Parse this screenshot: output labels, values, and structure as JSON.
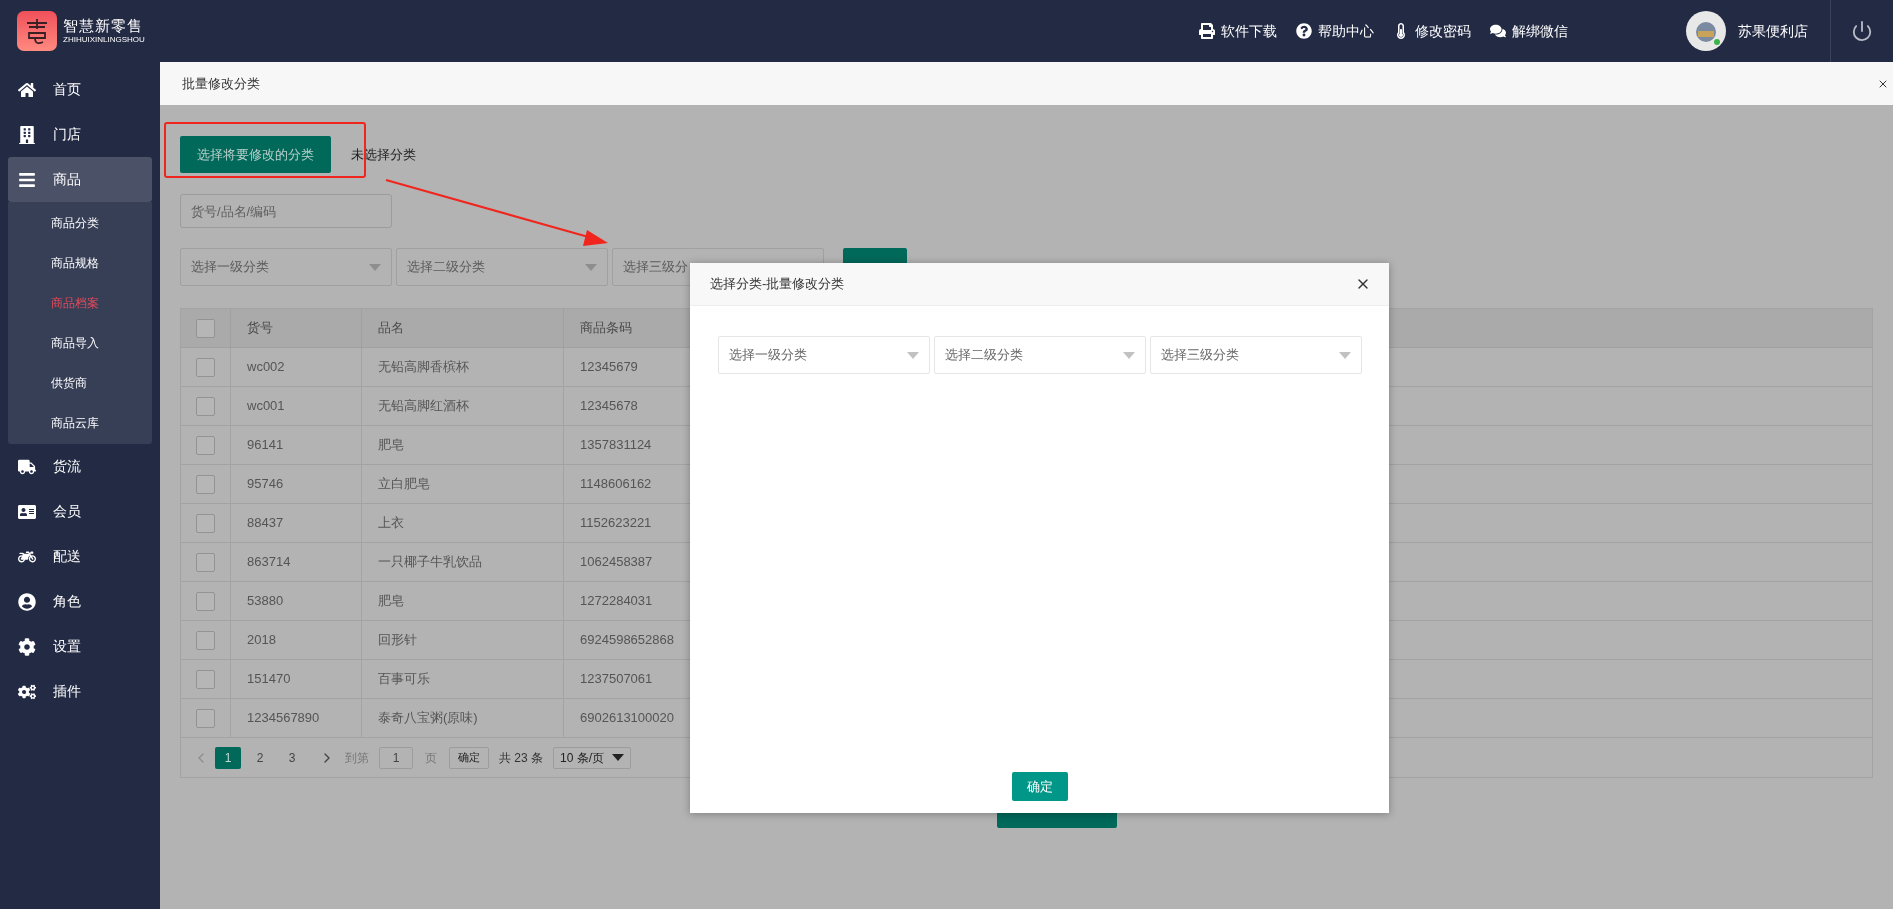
{
  "brand": {
    "name": "智慧新零售",
    "subtitle": "ZHIHUIXINLINGSHOU"
  },
  "top_links": [
    {
      "kind": "download",
      "label": "软件下载"
    },
    {
      "kind": "help",
      "label": "帮助中心"
    },
    {
      "kind": "password",
      "label": "修改密码"
    },
    {
      "kind": "wechat",
      "label": "解绑微信"
    }
  ],
  "user": {
    "name": "苏果便利店"
  },
  "sidebar": {
    "items": [
      {
        "kind": "home",
        "label": "首页",
        "selected": false
      },
      {
        "kind": "store",
        "label": "门店",
        "selected": false
      },
      {
        "kind": "goods",
        "label": "商品",
        "selected": true,
        "expanded": true,
        "children": [
          {
            "label": "商品分类",
            "selected": false
          },
          {
            "label": "商品规格",
            "selected": false
          },
          {
            "label": "商品档案",
            "selected": true
          },
          {
            "label": "商品导入",
            "selected": false
          },
          {
            "label": "供货商",
            "selected": false
          },
          {
            "label": "商品云库",
            "selected": false
          }
        ]
      },
      {
        "kind": "logistics",
        "label": "货流",
        "selected": false
      },
      {
        "kind": "member",
        "label": "会员",
        "selected": false
      },
      {
        "kind": "delivery",
        "label": "配送",
        "selected": false
      },
      {
        "kind": "role",
        "label": "角色",
        "selected": false
      },
      {
        "kind": "settings",
        "label": "设置",
        "selected": false
      },
      {
        "kind": "plugins",
        "label": "插件",
        "selected": false
      }
    ]
  },
  "page": {
    "title": "批量修改分类"
  },
  "toolbar": {
    "choose_button": "选择将要修改的分类",
    "selection_status": "未选择分类"
  },
  "search": {
    "placeholder": "货号/品名/编码"
  },
  "filters": [
    {
      "placeholder": "选择一级分类"
    },
    {
      "placeholder": "选择二级分类"
    },
    {
      "placeholder": "选择三级分"
    }
  ],
  "table": {
    "columns": [
      "货号",
      "品名",
      "商品条码"
    ],
    "header_checked": false,
    "rows": [
      {
        "checked": false,
        "cells": [
          "wc002",
          "无铅高脚香槟杯",
          "12345679"
        ]
      },
      {
        "checked": false,
        "cells": [
          "wc001",
          "无铅高脚红酒杯",
          "12345678"
        ]
      },
      {
        "checked": false,
        "cells": [
          "96141",
          "肥皂",
          "1357831124"
        ]
      },
      {
        "checked": false,
        "cells": [
          "95746",
          "立白肥皂",
          "1148606162"
        ]
      },
      {
        "checked": false,
        "cells": [
          "88437",
          "上衣",
          "1152623221"
        ]
      },
      {
        "checked": false,
        "cells": [
          "863714",
          "一只椰子牛乳饮品",
          "1062458387"
        ]
      },
      {
        "checked": false,
        "cells": [
          "53880",
          "肥皂",
          "1272284031"
        ]
      },
      {
        "checked": false,
        "cells": [
          "2018",
          "回形针",
          "6924598652868"
        ]
      },
      {
        "checked": false,
        "cells": [
          "151470",
          "百事可乐",
          "1237507061"
        ]
      },
      {
        "checked": false,
        "cells": [
          "1234567890",
          "泰奇八宝粥(原味)",
          "6902613100020"
        ]
      }
    ]
  },
  "pagination": {
    "pages": [
      {
        "label": "1",
        "selected": true
      },
      {
        "label": "2",
        "selected": false
      },
      {
        "label": "3",
        "selected": false
      }
    ],
    "goto_label": "到第",
    "page_input": "1",
    "page_suffix": "页",
    "confirm": "确定",
    "total": "共 23 条",
    "page_size": "10 条/页"
  },
  "dialog": {
    "title": "选择分类-批量修改分类",
    "selects": [
      {
        "placeholder": "选择一级分类"
      },
      {
        "placeholder": "选择二级分类"
      },
      {
        "placeholder": "选择三级分类"
      }
    ],
    "confirm": "确定"
  }
}
